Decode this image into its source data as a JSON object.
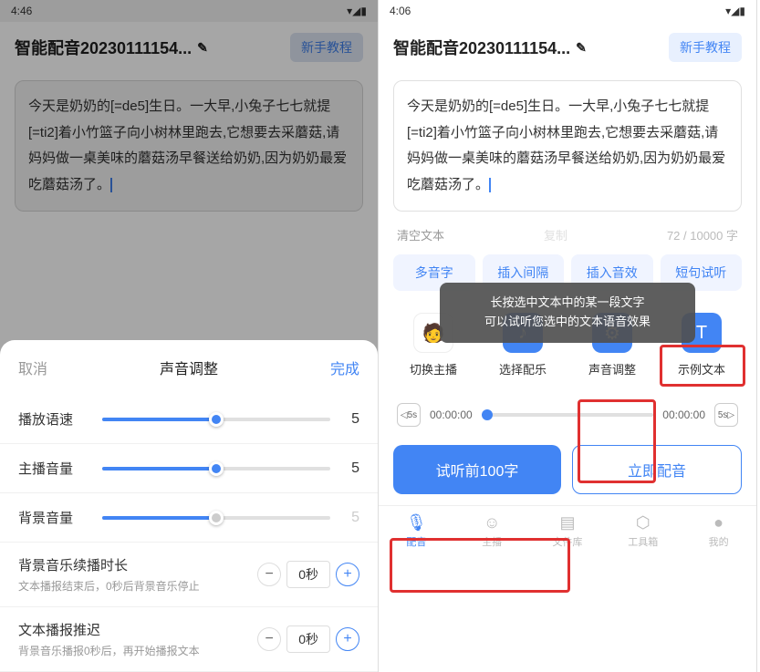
{
  "status": {
    "time": "4:46",
    "time2": "4:06"
  },
  "header": {
    "title": "智能配音20230111154...",
    "tutorial": "新手教程"
  },
  "text": "今天是奶奶的[=de5]生日。一大早,小兔子七七就提[=ti2]着小竹篮子向小树林里跑去,它想要去采蘑菇,请妈妈做一桌美味的蘑菇汤早餐送给奶奶,因为奶奶最爱吃蘑菇汤了。",
  "sheet": {
    "cancel": "取消",
    "title": "声音调整",
    "done": "完成",
    "sliders": [
      {
        "label": "播放语速",
        "value": "5",
        "pct": 50
      },
      {
        "label": "主播音量",
        "value": "5",
        "pct": 50
      },
      {
        "label": "背景音量",
        "value": "5",
        "pct": 50,
        "disabled": true
      }
    ],
    "settings": [
      {
        "title": "背景音乐续播时长",
        "desc": "文本播报结束后，0秒后背景音乐停止",
        "val": "0秒"
      },
      {
        "title": "文本播报推迟",
        "desc": "背景音乐播报0秒后，再开始播报文本",
        "val": "0秒"
      }
    ]
  },
  "toast": {
    "line1": "长按选中文本中的某一段文字",
    "line2": "可以试听您选中的文本语音效果"
  },
  "clear": {
    "label": "清空文本",
    "copy": "复制",
    "count": "72 / 10000 字"
  },
  "tabs": [
    "多音字",
    "插入间隔",
    "插入音效",
    "短句试听"
  ],
  "tools": [
    {
      "label": "切换主播",
      "icon": "👤"
    },
    {
      "label": "选择配乐",
      "icon": "♪"
    },
    {
      "label": "声音调整",
      "icon": "⚙"
    },
    {
      "label": "示例文本",
      "icon": "T"
    }
  ],
  "progress": {
    "time": "00:00:00",
    "skip": "5s"
  },
  "actions": {
    "preview": "试听前100字",
    "generate": "立即配音"
  },
  "nav": [
    {
      "label": "配音",
      "icon": "🎙"
    },
    {
      "label": "主播",
      "icon": "☺"
    },
    {
      "label": "文件库",
      "icon": "📁"
    },
    {
      "label": "工具箱",
      "icon": "⬡"
    },
    {
      "label": "我的",
      "icon": "●"
    }
  ]
}
